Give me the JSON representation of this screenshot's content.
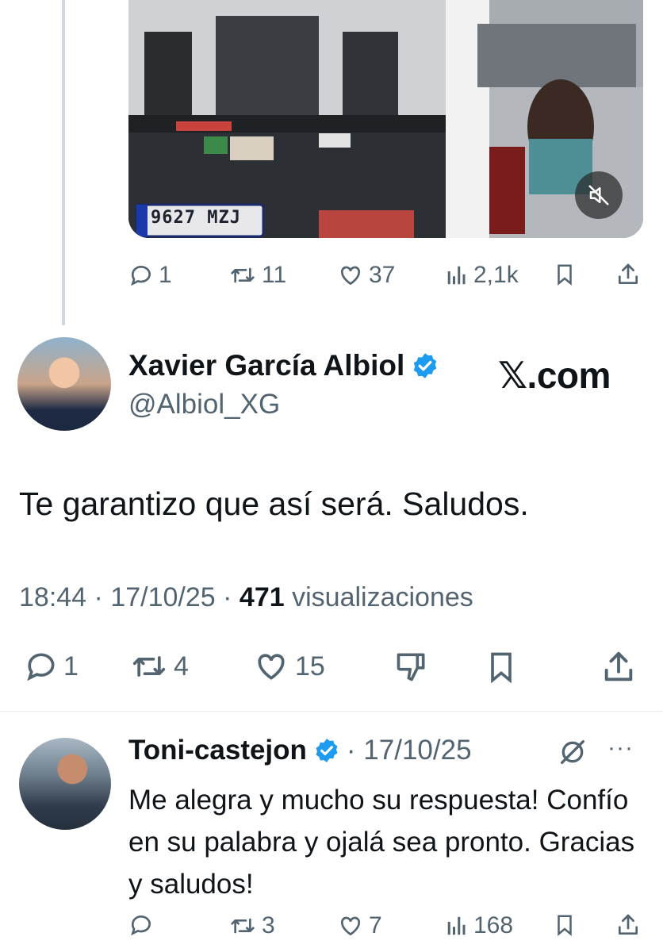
{
  "thread_parent": {
    "video": {
      "plate_text": "9627 MZJ",
      "mute_icon": "speaker-muted-icon"
    },
    "actions": {
      "replies": "1",
      "reposts": "11",
      "likes": "37",
      "views": "2,1k"
    }
  },
  "main_tweet": {
    "author_name": "Xavier García Albiol",
    "handle": "@Albiol_XG",
    "watermark": "𝕏.com",
    "text": "Te garantizo que así será. Saludos.",
    "time": "18:44",
    "date": "17/10/25",
    "views_count": "471",
    "views_label": "visualizaciones",
    "sep": "·",
    "actions": {
      "replies": "1",
      "reposts": "4",
      "likes": "15"
    }
  },
  "reply": {
    "author_name": "Toni-castejon",
    "date": "· 17/10/25",
    "text": "Me alegra y mucho su respuesta! Confío en su palabra y ojalá sea pronto. Gracias y saludos!",
    "more": "···",
    "actions": {
      "reposts": "3",
      "likes": "7",
      "views": "168"
    }
  },
  "colors": {
    "text": "#0f1419",
    "secondary": "#536471",
    "verified": "#1d9bf0",
    "thread_line": "#cfd9de"
  }
}
